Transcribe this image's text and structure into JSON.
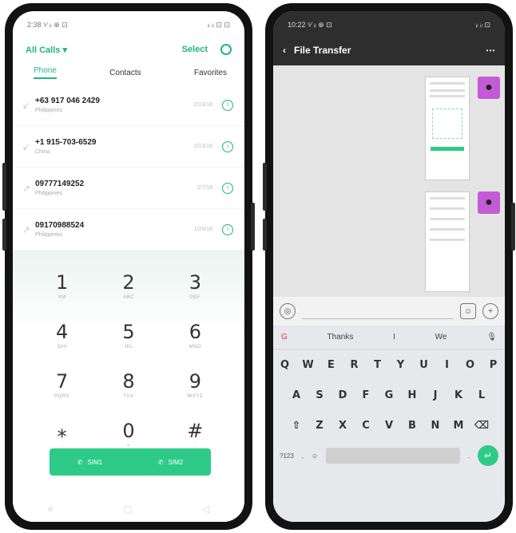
{
  "left_phone": {
    "status_time": "2:38 ⁵⁄ ᵢₗ ⊕ ⊡",
    "status_right": "ᵢₗ ᵢₗ ⊡ ⊡",
    "filter": "All Calls",
    "select": "Select",
    "tabs": [
      "Phone",
      "Contacts",
      "Favorites"
    ],
    "calls": [
      {
        "number": "+63 917 046 2429",
        "location": "Philippines",
        "time": "2/13/18"
      },
      {
        "number": "+1 915-703-6529",
        "location": "China",
        "time": "2/13/18"
      },
      {
        "number": "09777149252",
        "location": "Philippines",
        "time": "2/7/18"
      },
      {
        "number": "09170988524",
        "location": "Philippines",
        "time": "1/24/18"
      }
    ],
    "keys": [
      {
        "d": "1",
        "l": "VM"
      },
      {
        "d": "2",
        "l": "ABC"
      },
      {
        "d": "3",
        "l": "DEF"
      },
      {
        "d": "4",
        "l": "GHI"
      },
      {
        "d": "5",
        "l": "JKL"
      },
      {
        "d": "6",
        "l": "MNO"
      },
      {
        "d": "7",
        "l": "PQRS"
      },
      {
        "d": "8",
        "l": "TUV"
      },
      {
        "d": "9",
        "l": "WXYZ"
      },
      {
        "d": "⁎",
        "l": ","
      },
      {
        "d": "0",
        "l": "+"
      },
      {
        "d": "#",
        "l": ";"
      }
    ],
    "sim1": "SIM1",
    "sim2": "SIM2"
  },
  "right_phone": {
    "status_time": "10:22 ⁵⁄ ᵢₗ ⊕ ⊡",
    "status_right": "ᵢₗ ᵢₗ ⊡",
    "title": "File Transfer",
    "suggestions": [
      "Thanks",
      "I",
      "We"
    ],
    "rows": [
      [
        "Q",
        "W",
        "E",
        "R",
        "T",
        "Y",
        "U",
        "I",
        "O",
        "P"
      ],
      [
        "A",
        "S",
        "D",
        "F",
        "G",
        "H",
        "J",
        "K",
        "L"
      ],
      [
        "Z",
        "X",
        "C",
        "V",
        "B",
        "N",
        "M"
      ]
    ],
    "symbols_key": "?123"
  }
}
